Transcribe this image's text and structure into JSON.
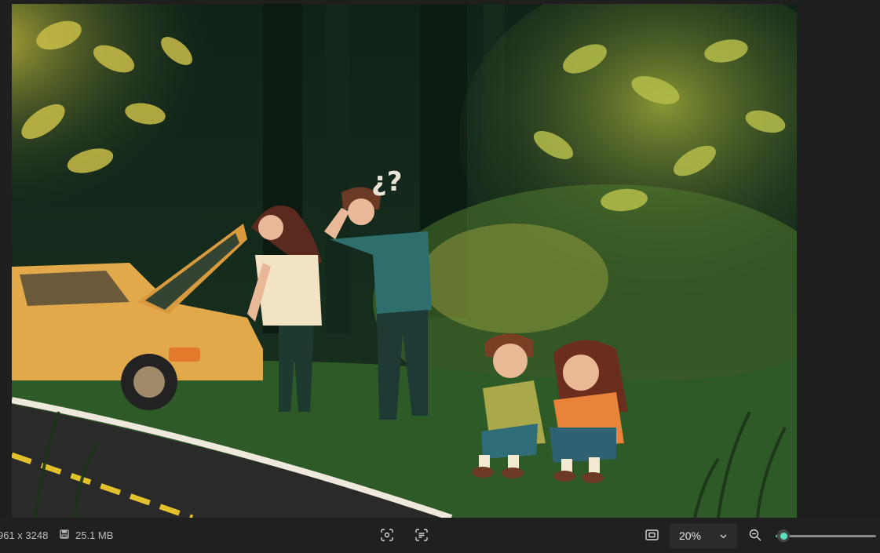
{
  "image": {
    "description_colors": {
      "road": "#2a2a2a",
      "grass": "#2e5a28",
      "car": "#e2a94b",
      "foliage_light": "#c9c34a",
      "forest_dark": "#0f1f14"
    }
  },
  "statusbar": {
    "dimensions": "961 x 3248",
    "file_size": "25.1 MB",
    "zoom_value": "20%",
    "zoom_slider_fraction": 0.08
  },
  "icons": {
    "disk": "save-disk-icon",
    "fit": "fit-to-screen-icon",
    "text_detect": "text-scan-icon",
    "actual_size": "actual-size-icon",
    "chevron": "chevron-down-icon",
    "zoom_out": "zoom-out-icon"
  }
}
